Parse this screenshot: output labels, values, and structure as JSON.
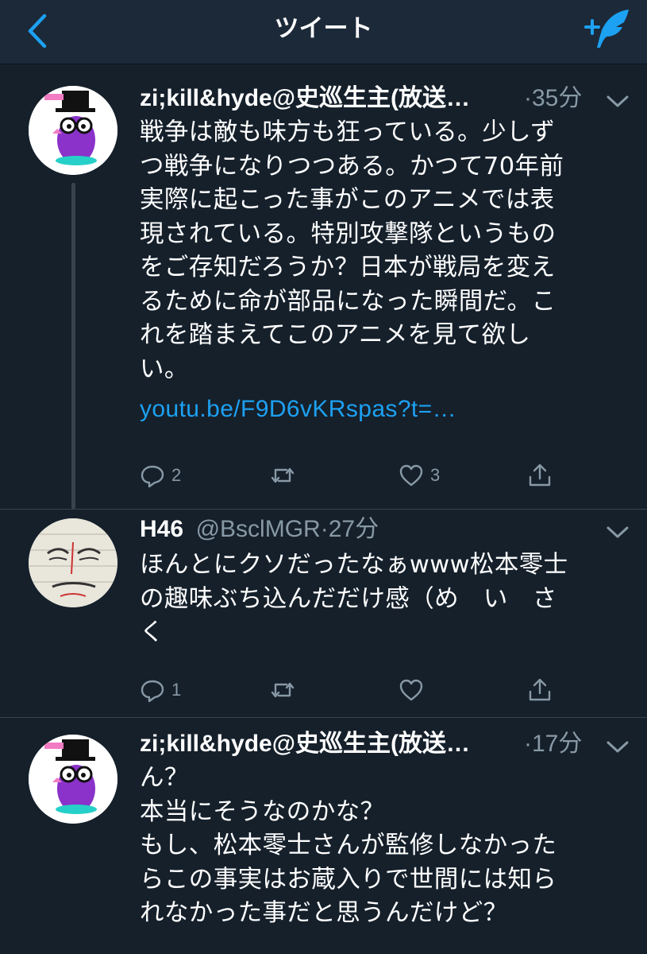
{
  "header": {
    "title": "ツイート"
  },
  "tweets": [
    {
      "name": "zi;kill&hyde@史巡生主(放送…",
      "time": "·35分",
      "lines": [
        "戦争は敵も味方も狂っている。少しず",
        "つ戦争になりつつある。かつて70年前",
        "実際に起こった事がこのアニメでは表",
        "現されている。特別攻撃隊というもの",
        "をご存知だろうか？日本が戦局を変え",
        "るために命が部品になった瞬間だ。こ",
        "れを踏まえてこのアニメを見て欲し",
        "い。"
      ],
      "link": "youtu.be/F9D6vKRspas?t=…",
      "replies": "2",
      "retweets": "",
      "likes": "3"
    },
    {
      "name": "H46",
      "handle": "@BsclMGR",
      "time": "·27分",
      "lines": [
        "ほんとにクソだったなぁwww松本零士",
        "の趣味ぶち込んだだけ感（め　い　さ",
        "く"
      ],
      "replies": "1",
      "retweets": "",
      "likes": ""
    },
    {
      "name": "zi;kill&hyde@史巡生主(放送…",
      "time": "·17分",
      "lines": [
        "ん？",
        "本当にそうなのかな？",
        "もし、松本零士さんが監修しなかった",
        "らこの事実はお蔵入りで世間には知ら",
        "れなかった事だと思うんだけど？"
      ]
    }
  ]
}
